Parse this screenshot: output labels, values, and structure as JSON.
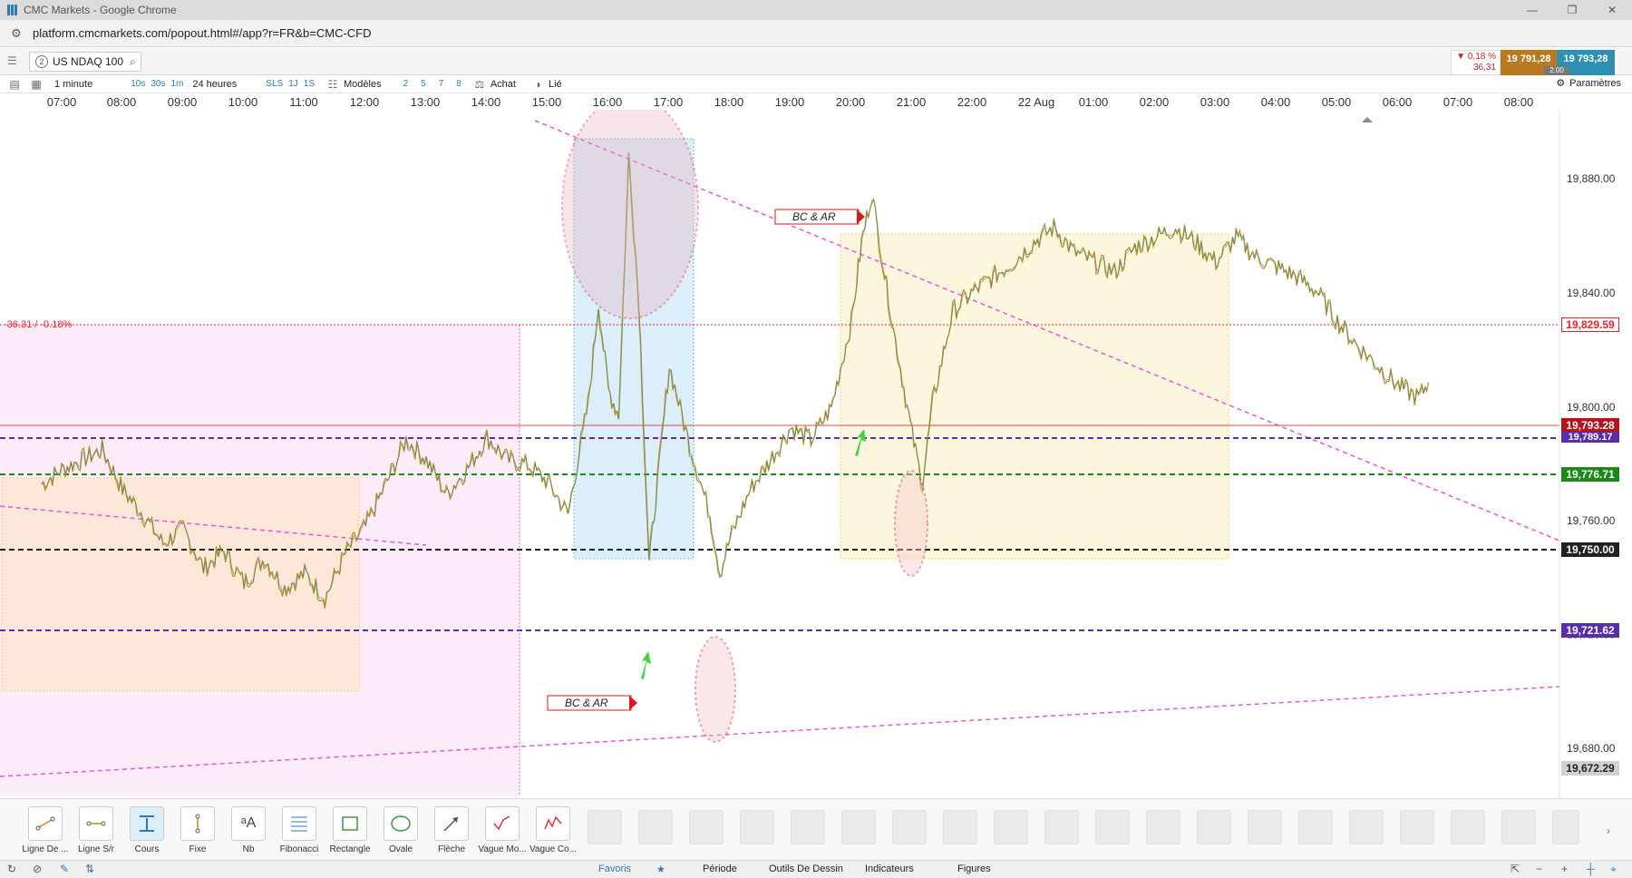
{
  "browser": {
    "title": "CMC Markets - Google Chrome",
    "url": "platform.cmcmarkets.com/popout.html#/app?r=FR&b=CMC-CFD"
  },
  "instrument": {
    "badge": "2",
    "name": "US NDAQ 100"
  },
  "quote": {
    "change_pct": "▼ 0,18 %",
    "change_abs": "36,31",
    "sell": "19 791,28",
    "buy": "19 793,28",
    "spread": "2.00"
  },
  "toolbar": {
    "interval": "1 minute",
    "quick_intervals": [
      "10s",
      "30s",
      "1m"
    ],
    "range": "24 heures",
    "quick_ranges": [
      "SLS",
      "1J",
      "1S"
    ],
    "templates": "Modèles",
    "layouts": [
      "2",
      "5",
      "7",
      "8"
    ],
    "mode": "Achat",
    "linked": "Lié",
    "settings": "Paramètres"
  },
  "time_axis": [
    "07:00",
    "08:00",
    "09:00",
    "10:00",
    "11:00",
    "12:00",
    "13:00",
    "14:00",
    "15:00",
    "16:00",
    "17:00",
    "18:00",
    "19:00",
    "20:00",
    "21:00",
    "22:00",
    "22 Aug",
    "01:00",
    "02:00",
    "03:00",
    "04:00",
    "05:00",
    "06:00",
    "07:00",
    "08:00"
  ],
  "chart_data": {
    "type": "line",
    "title": "",
    "xlabel": "",
    "ylabel": "",
    "ylim": [
      19665,
      19900
    ],
    "y_ticks": [
      "19,880.00",
      "19,840.00",
      "19,800.00",
      "19,760.00",
      "19,720.00",
      "19,680.00"
    ],
    "series": [
      {
        "x": [
          "06:40",
          "07:00",
          "07:20",
          "07:40",
          "08:00",
          "08:20",
          "08:40",
          "09:00",
          "09:20",
          "09:40",
          "10:00",
          "10:20",
          "10:40",
          "11:00",
          "11:20",
          "11:40",
          "12:00",
          "12:20",
          "12:40",
          "13:00",
          "13:20",
          "13:40",
          "14:00",
          "14:20",
          "14:40",
          "15:00",
          "15:20",
          "15:40",
          "15:50",
          "16:00",
          "16:10",
          "16:20",
          "16:30",
          "16:40",
          "16:50",
          "17:00",
          "17:20",
          "17:40",
          "17:50",
          "18:00",
          "18:20",
          "18:40",
          "19:00",
          "19:20",
          "19:40",
          "20:00",
          "20:10",
          "20:20",
          "20:40",
          "20:50",
          "21:00",
          "21:10",
          "21:20",
          "21:40",
          "22:00",
          "22:20",
          "22:40",
          "23:00",
          "23:20",
          "23:40",
          "00:00",
          "00:20",
          "00:40",
          "01:00",
          "01:20",
          "01:40",
          "02:00",
          "02:20",
          "02:40",
          "03:00",
          "03:20",
          "03:40",
          "04:00",
          "04:20",
          "04:40",
          "05:00",
          "05:20",
          "05:30"
        ],
        "values": [
          19752,
          19758,
          19762,
          19766,
          19750,
          19740,
          19728,
          19734,
          19718,
          19725,
          19712,
          19722,
          19710,
          19716,
          19706,
          19724,
          19735,
          19752,
          19770,
          19762,
          19748,
          19758,
          19771,
          19762,
          19760,
          19753,
          19740,
          19785,
          19825,
          19790,
          19780,
          19885,
          19825,
          19720,
          19760,
          19800,
          19768,
          19740,
          19716,
          19730,
          19750,
          19762,
          19775,
          19770,
          19783,
          19818,
          19850,
          19870,
          19818,
          19795,
          19772,
          19752,
          19785,
          19822,
          19830,
          19836,
          19842,
          19850,
          19856,
          19846,
          19842,
          19838,
          19848,
          19852,
          19856,
          19850,
          19842,
          19852,
          19844,
          19840,
          19836,
          19830,
          19818,
          19808,
          19800,
          19792,
          19787,
          19793.28
        ]
      }
    ],
    "levels": [
      {
        "value": "19,829.59",
        "color": "#e8212b",
        "style": "dotted"
      },
      {
        "value": "19,793.28",
        "color": "#b5121b",
        "style": "solid"
      },
      {
        "value": "19,789.17",
        "color": "#5a2ea6",
        "style": "dashed"
      },
      {
        "value": "19,776.71",
        "color": "#1b8a1b",
        "style": "dashed"
      },
      {
        "value": "19,750.00",
        "color": "#222222",
        "style": "dashed"
      },
      {
        "value": "19,721.62",
        "color": "#5a2ea6",
        "style": "dashed"
      },
      {
        "value": "19,672.29",
        "color": "#666666",
        "style": "tag"
      }
    ]
  },
  "annotations": {
    "bc_ar_top": "BC & AR",
    "bc_ar_bottom": "BC & AR",
    "change_label": "-36.31 / -0.18%"
  },
  "tools": [
    {
      "label": "Ligne De ...",
      "icon": "line-icon"
    },
    {
      "label": "Ligne S/r",
      "icon": "sr-line-icon"
    },
    {
      "label": "Cours",
      "icon": "price-icon"
    },
    {
      "label": "Fixe",
      "icon": "fixed-icon"
    },
    {
      "label": "Nb",
      "icon": "text-icon"
    },
    {
      "label": "Fibonacci",
      "icon": "fibonacci-icon"
    },
    {
      "label": "Rectangle",
      "icon": "rectangle-icon"
    },
    {
      "label": "Ovale",
      "icon": "ellipse-icon"
    },
    {
      "label": "Flèche",
      "icon": "arrow-icon"
    },
    {
      "label": "Vague Mo...",
      "icon": "wave-icon"
    },
    {
      "label": "Vague Co...",
      "icon": "wave-co-icon"
    }
  ],
  "tabs": {
    "favoris": "Favoris",
    "periode": "Période",
    "outils": "Outils De Dessin",
    "indicateurs": "Indicateurs",
    "figures": "Figures"
  }
}
